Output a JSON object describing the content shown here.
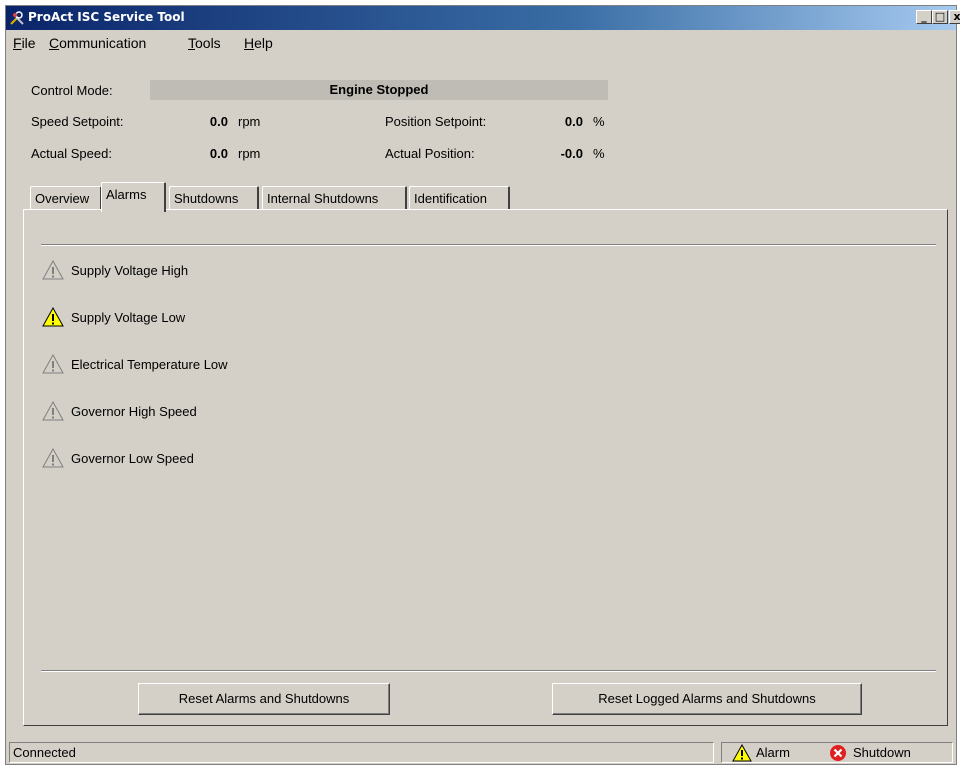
{
  "window": {
    "title": "ProAct ISC Service Tool",
    "controls": [
      "_",
      "□",
      "x"
    ]
  },
  "menu": [
    {
      "label": "File",
      "mnemonic": "F",
      "rest": "ile"
    },
    {
      "label": "Communication",
      "mnemonic": "C",
      "rest": "ommunication"
    },
    {
      "label": "Tools",
      "mnemonic": "T",
      "rest": "ools"
    },
    {
      "label": "Help",
      "mnemonic": "H",
      "rest": "elp"
    }
  ],
  "status": {
    "control_mode_label": "Control Mode:",
    "control_mode_value": "Engine Stopped",
    "speed_setpoint_label": "Speed Setpoint:",
    "speed_setpoint_value": "0.0",
    "speed_setpoint_unit": "rpm",
    "actual_speed_label": "Actual Speed:",
    "actual_speed_value": "0.0",
    "actual_speed_unit": "rpm",
    "position_setpoint_label": "Position Setpoint:",
    "position_setpoint_value": "0.0",
    "position_setpoint_unit": "%",
    "actual_position_label": "Actual Position:",
    "actual_position_value": "-0.0",
    "actual_position_unit": "%"
  },
  "tabs": [
    {
      "label": "Overview",
      "active": false
    },
    {
      "label": "Alarms",
      "active": true
    },
    {
      "label": "Shutdowns",
      "active": false
    },
    {
      "label": "Internal Shutdowns",
      "active": false
    },
    {
      "label": "Identification",
      "active": false
    }
  ],
  "alarms": [
    {
      "label": "Supply Voltage High",
      "active": false,
      "icon": "warning-icon"
    },
    {
      "label": "Supply Voltage Low",
      "active": true,
      "icon": "warning-icon"
    },
    {
      "label": "Electrical Temperature Low",
      "active": false,
      "icon": "warning-icon"
    },
    {
      "label": "Governor High Speed",
      "active": false,
      "icon": "warning-icon"
    },
    {
      "label": "Governor Low Speed",
      "active": false,
      "icon": "warning-icon"
    }
  ],
  "buttons": {
    "reset": "Reset Alarms and Shutdowns",
    "reset_logged": "Reset Logged Alarms and Shutdowns"
  },
  "statusbar": {
    "connection": "Connected",
    "alarm_label": "Alarm",
    "shutdown_label": "Shutdown"
  },
  "colors": {
    "warning_active": "#ffff00",
    "warning_inactive": "#d4d0c8",
    "shutdown": "#e02020",
    "titlebar": "#0a246a"
  }
}
